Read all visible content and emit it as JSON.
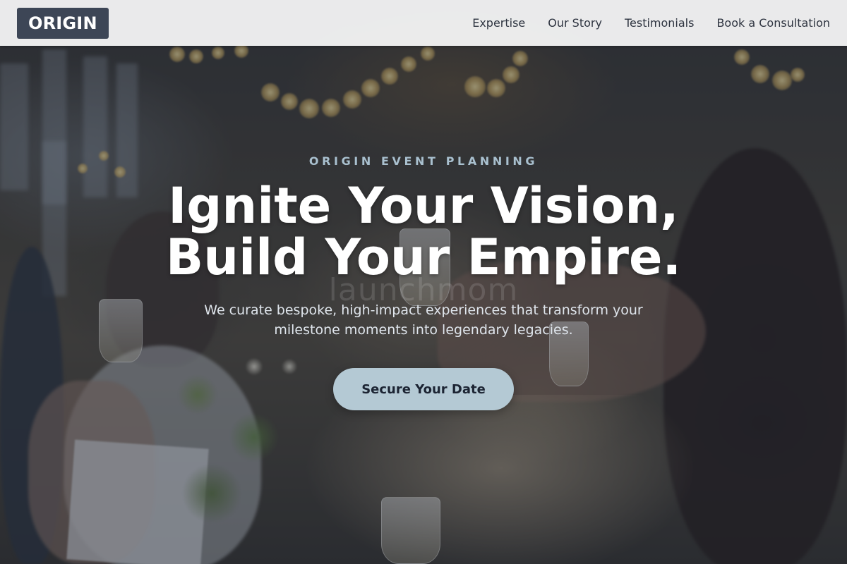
{
  "navbar": {
    "logo_text": "ORIGIN",
    "links": [
      {
        "label": "Expertise"
      },
      {
        "label": "Our Story"
      },
      {
        "label": "Testimonials"
      },
      {
        "label": "Book a Consultation"
      }
    ]
  },
  "hero": {
    "eyebrow": "ORIGIN EVENT PLANNING",
    "headline_line1": "Ignite Your Vision,",
    "headline_line2": "Build Your Empire.",
    "watermark": "launchmom",
    "subcopy_line1": "We curate bespoke, high-impact experiences that transform your",
    "subcopy_line2": "milestone moments into legendary legacies.",
    "cta_label": "Secure Your Date",
    "background_image": "blurred-wedding-reception-toast-photo"
  },
  "colors": {
    "logo_bg": "#3d4656",
    "navbar_bg": "#f2f2f2",
    "eyebrow_text": "#a9c0cf",
    "cta_bg": "#b4c9d4",
    "cta_text": "#1c2433"
  }
}
